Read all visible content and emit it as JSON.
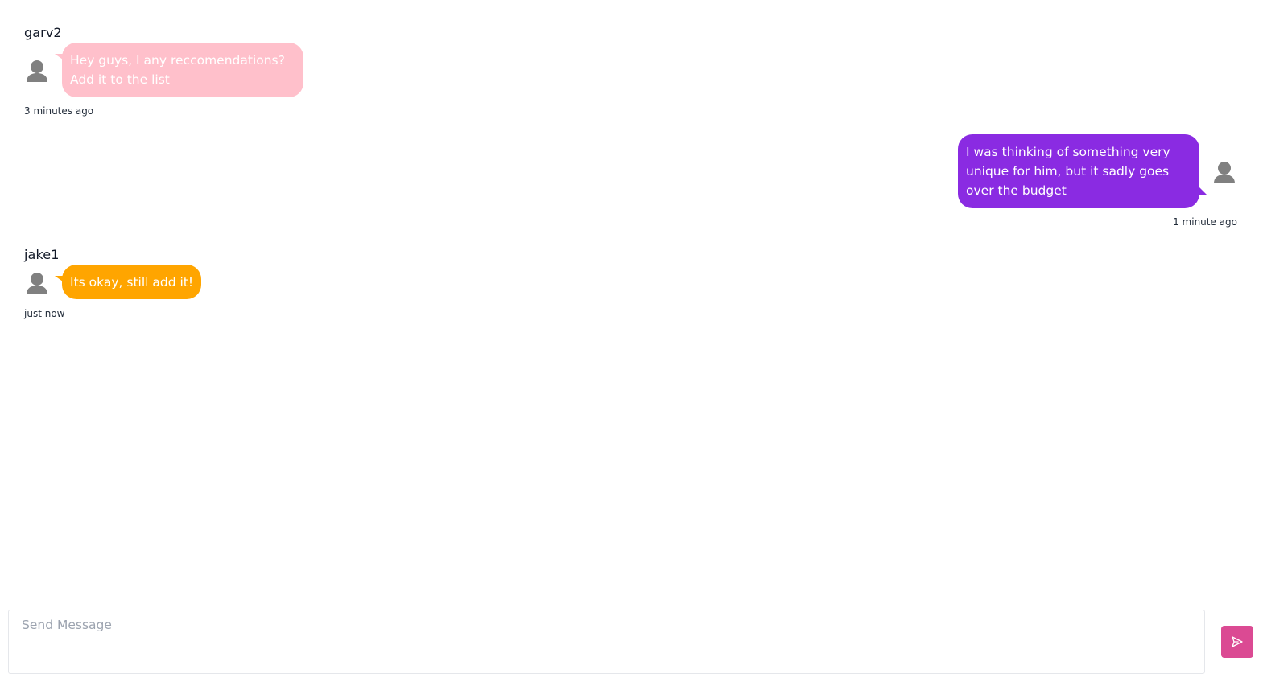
{
  "colors": {
    "bubble_garv2": "#ffc0cb",
    "bubble_self": "#8a2be2",
    "bubble_jake1": "#ffa500",
    "avatar": "#808080",
    "send_button": "#db4a93"
  },
  "messages": [
    {
      "sender": "garv2",
      "text": "Hey guys, I any reccomendations? Add it to the list",
      "time": "3 minutes ago",
      "side": "left",
      "avatar_icon": "user-avatar-icon"
    },
    {
      "sender": "",
      "text": "I was thinking of something very unique for him, but it sadly goes over the budget",
      "time": "1 minute ago",
      "side": "right",
      "avatar_icon": "user-avatar-icon"
    },
    {
      "sender": "jake1",
      "text": "Its okay, still add it!",
      "time": "just now",
      "side": "left",
      "avatar_icon": "user-avatar-icon"
    }
  ],
  "composer": {
    "placeholder": "Send Message",
    "value": "",
    "send_icon": "send-icon"
  }
}
